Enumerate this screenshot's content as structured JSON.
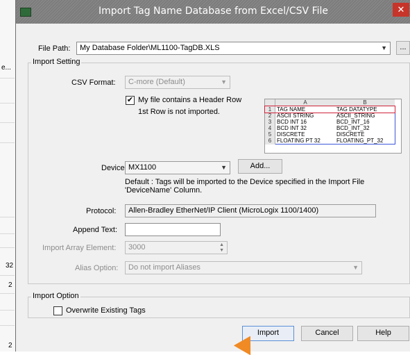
{
  "background": {
    "snippets": [
      "e...",
      "32",
      "2",
      "2"
    ]
  },
  "dialog": {
    "title": "Import Tag Name Database from Excel/CSV File",
    "close_symbol": "✕",
    "file_path": {
      "label": "File Path:",
      "value": "My Database Folder\\ML1100-TagDB.XLS",
      "browse_label": "..."
    },
    "import_setting": {
      "title": "Import Setting",
      "csv_format": {
        "label": "CSV Format:",
        "value": "C-more (Default)"
      },
      "header_row": {
        "label": "My file contains a Header Row",
        "checked": true,
        "note": "1st Row is not imported."
      },
      "device": {
        "label": "Device:",
        "value": "MX1100",
        "add_label": "Add..."
      },
      "device_note": "Default : Tags will be imported to the Device specified in the Import File 'DeviceName' Column.",
      "protocol": {
        "label": "Protocol:",
        "value": "Allen-Bradley EtherNet/IP Client (MicroLogix 1100/1400)"
      },
      "append_text": {
        "label": "Append Text:",
        "value": ""
      },
      "import_array_element": {
        "label": "Import Array Element:",
        "value": "3000"
      },
      "alias_option": {
        "label": "Alias Option:",
        "value": "Do not import Aliases"
      }
    },
    "sample_sheet": {
      "columns": [
        "A",
        "B"
      ],
      "rows": [
        {
          "n": "1",
          "a": "TAG NAME",
          "b": "TAG DATATYPE"
        },
        {
          "n": "2",
          "a": "ASCII STRING",
          "b": "ASCII_STRING"
        },
        {
          "n": "3",
          "a": "BCD INT 16",
          "b": "BCD_INT_16"
        },
        {
          "n": "4",
          "a": "BCD INT 32",
          "b": "BCD_INT_32"
        },
        {
          "n": "5",
          "a": "DISCRETE",
          "b": "DISCRETE"
        },
        {
          "n": "6",
          "a": "FLOATING PT 32",
          "b": "FLOATING_PT_32"
        }
      ],
      "header_outline_color": "#d0213a",
      "data_outline_color": "#3b56d9"
    },
    "import_option": {
      "title": "Import Option",
      "overwrite": {
        "label": "Overwrite Existing Tags",
        "checked": false
      }
    },
    "buttons": {
      "import": "Import",
      "cancel": "Cancel",
      "help": "Help"
    }
  }
}
